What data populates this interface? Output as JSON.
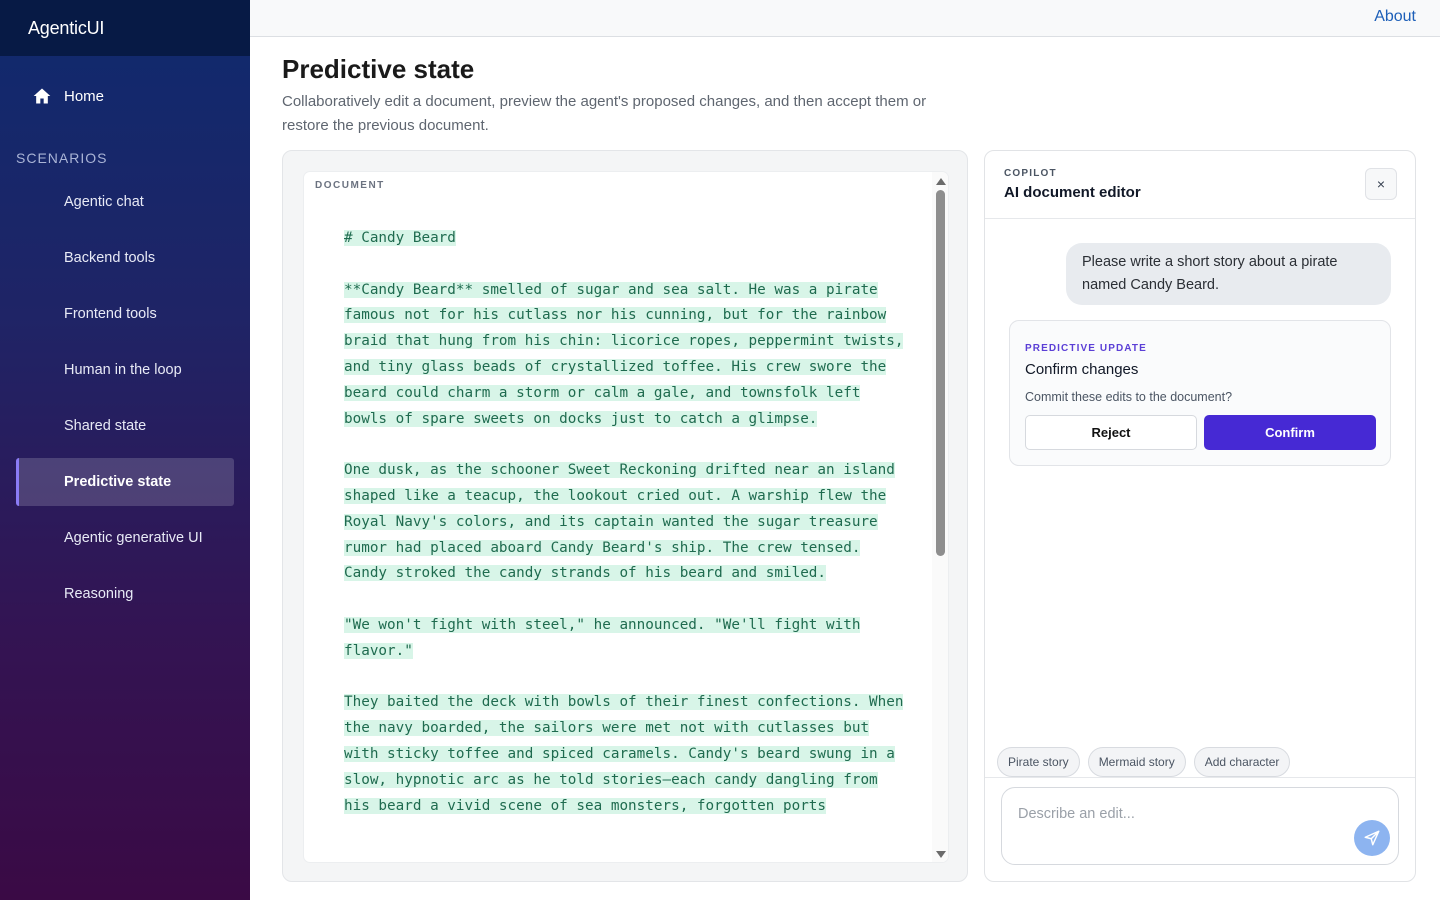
{
  "app": {
    "brand": "AgenticUI"
  },
  "topbar": {
    "about_label": "About"
  },
  "sidebar": {
    "home_label": "Home",
    "section_label": "SCENARIOS",
    "items": [
      {
        "label": "Agentic chat"
      },
      {
        "label": "Backend tools"
      },
      {
        "label": "Frontend tools"
      },
      {
        "label": "Human in the loop"
      },
      {
        "label": "Shared state"
      },
      {
        "label": "Predictive state",
        "active": true
      },
      {
        "label": "Agentic generative UI"
      },
      {
        "label": "Reasoning"
      }
    ]
  },
  "page": {
    "title": "Predictive state",
    "description": "Collaboratively edit a document, preview the agent's proposed changes, and then accept them or restore the previous document."
  },
  "document": {
    "label": "DOCUMENT",
    "paragraphs": [
      "# Candy Beard",
      "**Candy Beard** smelled of sugar and sea salt. He was a pirate famous not for his cutlass nor his cunning, but for the rainbow braid that hung from his chin: licorice ropes, peppermint twists, and tiny glass beads of crystallized toffee. His crew swore the beard could charm a storm or calm a gale, and townsfolk left bowls of spare sweets on docks just to catch a glimpse.",
      "One dusk, as the schooner Sweet Reckoning drifted near an island shaped like a teacup, the lookout cried out. A warship flew the Royal Navy's colors, and its captain wanted the sugar treasure rumor had placed aboard Candy Beard's ship. The crew tensed. Candy stroked the candy strands of his beard and smiled.",
      "\"We won't fight with steel,\" he announced. \"We'll fight with flavor.\"",
      "They baited the deck with bowls of their finest confections. When the navy boarded, the sailors were met not with cutlasses but with sticky toffee and spiced caramels. Candy's beard swung in a slow, hypnotic arc as he told stories—each candy dangling from his beard a vivid scene of sea monsters, forgotten ports"
    ]
  },
  "copilot": {
    "kicker": "COPILOT",
    "title": "AI document editor",
    "close_label": "×",
    "user_message": "Please write a short story about a pirate named Candy Beard.",
    "prediction": {
      "kicker": "PREDICTIVE UPDATE",
      "title": "Confirm changes",
      "text": "Commit these edits to the document?",
      "reject_label": "Reject",
      "confirm_label": "Confirm"
    },
    "chips": [
      "Pirate story",
      "Mermaid story",
      "Add character"
    ],
    "input_placeholder": "Describe an edit...",
    "send_icon": "send-icon"
  },
  "colors": {
    "accent": "#4629d4",
    "highlight": "#d8f5e8",
    "doc_text": "#1f6b4f"
  }
}
